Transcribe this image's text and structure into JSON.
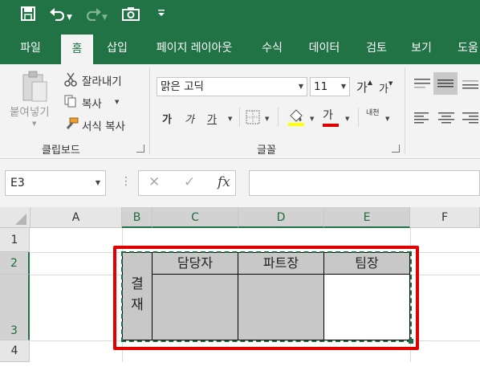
{
  "colors": {
    "brand": "#217346",
    "selection_outline": "#e00000",
    "cell_fill": "#c8c8c8"
  },
  "qat": {
    "save_icon": "save-icon",
    "undo_icon": "undo-icon",
    "redo_icon": "redo-icon",
    "camera_icon": "camera-icon",
    "customize_icon": "customize-icon"
  },
  "tabs": [
    {
      "label": "파일"
    },
    {
      "label": "홈"
    },
    {
      "label": "삽입"
    },
    {
      "label": "페이지 레이아웃"
    },
    {
      "label": "수식"
    },
    {
      "label": "데이터"
    },
    {
      "label": "검토"
    },
    {
      "label": "보기"
    },
    {
      "label": "도움"
    }
  ],
  "clipboard": {
    "paste": "붙여넣기",
    "cut": "잘라내기",
    "copy": "복사",
    "format_painter": "서식 복사",
    "group_label": "클립보드"
  },
  "font": {
    "family": "맑은 고딕",
    "size": "11",
    "grow": "가",
    "shrink": "가",
    "bold": "가",
    "italic": "가",
    "underline": "가",
    "font_color_glyph": "가",
    "phonetic": "내천",
    "group_label": "글꼴"
  },
  "formula_bar": {
    "name_box": "E3",
    "fx": "fx",
    "cancel": "✕",
    "enter": "✓",
    "formula_value": ""
  },
  "grid": {
    "columns": [
      "A",
      "B",
      "C",
      "D",
      "E",
      "F"
    ],
    "rows": [
      "1",
      "2",
      "3",
      "4"
    ],
    "cells": {
      "B2": "결\n재",
      "C2": "담당자",
      "D2": "파트장",
      "E2": "팀장"
    }
  }
}
